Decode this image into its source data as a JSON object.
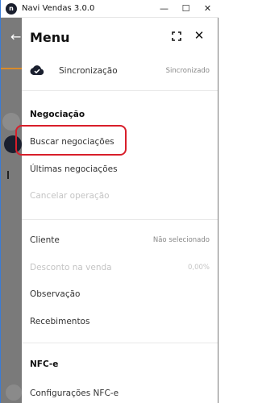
{
  "window": {
    "title": "Navi Vendas 3.0.0",
    "app_icon_letter": "n",
    "minimize": "—",
    "maximize": "☐",
    "close": "✕"
  },
  "background": {
    "back_arrow": "←"
  },
  "drawer": {
    "title": "Menu",
    "sync": {
      "label": "Sincronização",
      "status": "Sincronizado"
    },
    "negociacao": {
      "title": "Negociação",
      "items": [
        {
          "label": "Buscar negociações",
          "disabled": false
        },
        {
          "label": "Últimas negociações",
          "disabled": false
        },
        {
          "label": "Cancelar operação",
          "disabled": true
        }
      ]
    },
    "venda": {
      "cliente": {
        "label": "Cliente",
        "value": "Não selecionado"
      },
      "desconto": {
        "label": "Desconto na venda",
        "value": "0,00%"
      },
      "observacao": {
        "label": "Observação"
      },
      "recebimentos": {
        "label": "Recebimentos"
      }
    },
    "nfce": {
      "title": "NFC-e",
      "items": [
        {
          "label": "Configurações NFC-e"
        }
      ]
    }
  },
  "colors": {
    "highlight": "#d81e2a",
    "accent_line": "#d98b2a",
    "overlay": "#7a7a7a"
  }
}
